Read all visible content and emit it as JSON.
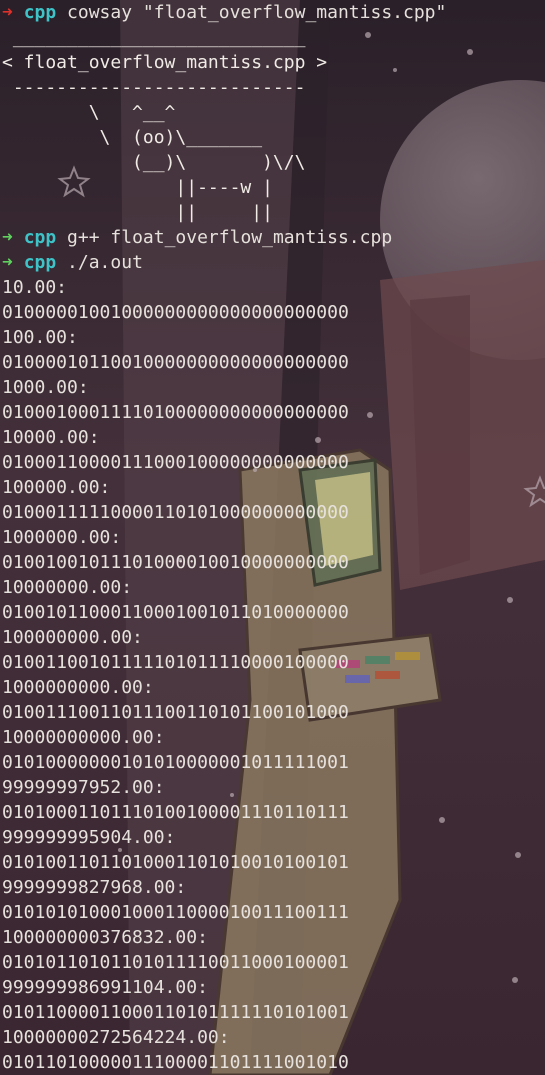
{
  "colors": {
    "background": "#3a2730",
    "text": "#e6e1dc",
    "arrow_error": "#e0302a",
    "arrow_ok": "#5fd15f",
    "dir": "#3ec4c8"
  },
  "prompt": {
    "arrow": "➜",
    "dir": "cpp"
  },
  "commands": {
    "cowsay": "cowsay \"float_overflow_mantiss.cpp\"",
    "compile": "g++ float_overflow_mantiss.cpp",
    "run": "./a.out"
  },
  "cowsay_art": [
    " ___________________________",
    "< float_overflow_mantiss.cpp >",
    " ---------------------------",
    "        \\   ^__^",
    "         \\  (oo)\\_______",
    "            (__)\\       )\\/\\",
    "                ||----w |",
    "                ||     ||"
  ],
  "output": [
    {
      "value": "10.00:",
      "bits": "01000001001000000000000000000000"
    },
    {
      "value": "100.00:",
      "bits": "01000010110010000000000000000000"
    },
    {
      "value": "1000.00:",
      "bits": "01000100011110100000000000000000"
    },
    {
      "value": "10000.00:",
      "bits": "01000110000111000100000000000000"
    },
    {
      "value": "100000.00:",
      "bits": "01000111110000110101000000000000"
    },
    {
      "value": "1000000.00:",
      "bits": "01001001011101000010010000000000"
    },
    {
      "value": "10000000.00:",
      "bits": "01001011000110001001011010000000"
    },
    {
      "value": "100000000.00:",
      "bits": "01001100101111101011110000100000"
    },
    {
      "value": "1000000000.00:",
      "bits": "01001110011011100110101100101000"
    },
    {
      "value": "10000000000.00:",
      "bits": "01010000000101010000001011111001"
    },
    {
      "value": "99999997952.00:",
      "bits": "01010001101110100100001110110111"
    },
    {
      "value": "999999995904.00:",
      "bits": "01010011011010001101010010100101"
    },
    {
      "value": "9999999827968.00:",
      "bits": "01010101000100011000010011100111"
    },
    {
      "value": "100000000376832.00:",
      "bits": "01010110101101011110011000100001"
    },
    {
      "value": "999999986991104.00:",
      "bits": "01011000011000110101111110101001"
    },
    {
      "value": "10000000272564224.00:",
      "bits": "01011010000011100001101111001010"
    }
  ]
}
